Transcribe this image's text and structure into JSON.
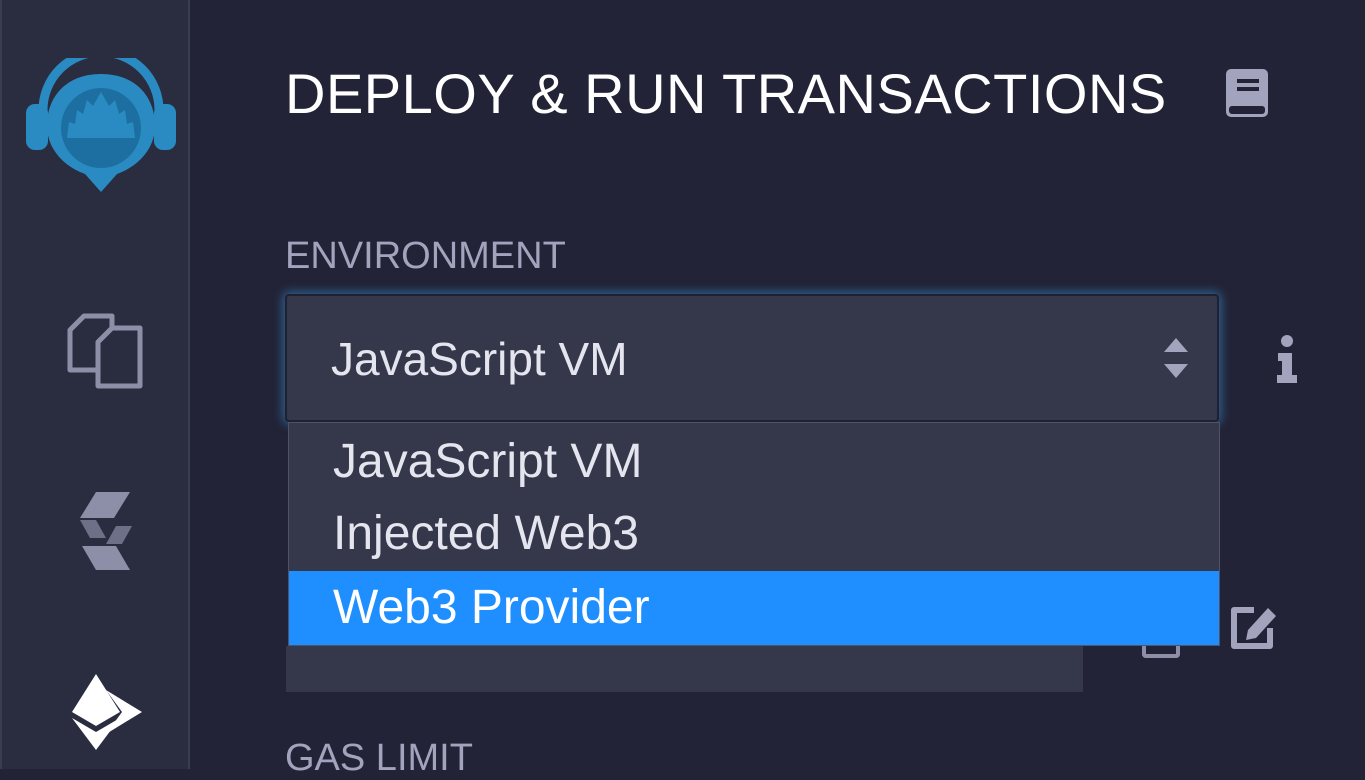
{
  "sidebar": {
    "icons": [
      "remix-logo-icon",
      "file-explorers-icon",
      "solidity-compiler-icon",
      "deploy-run-icon"
    ]
  },
  "panel": {
    "title": "DEPLOY & RUN TRANSACTIONS",
    "environment": {
      "label": "ENVIRONMENT",
      "selected": "JavaScript VM",
      "options": [
        "JavaScript VM",
        "Injected Web3",
        "Web3 Provider"
      ],
      "highlighted_option": "Web3 Provider"
    },
    "gas_limit": {
      "label": "GAS LIMIT"
    }
  },
  "colors": {
    "background": "#222336",
    "sidebar": "#2a2c3f",
    "input": "#35374a",
    "accent": "#1f8fff",
    "logo": "#2a8bc3"
  }
}
